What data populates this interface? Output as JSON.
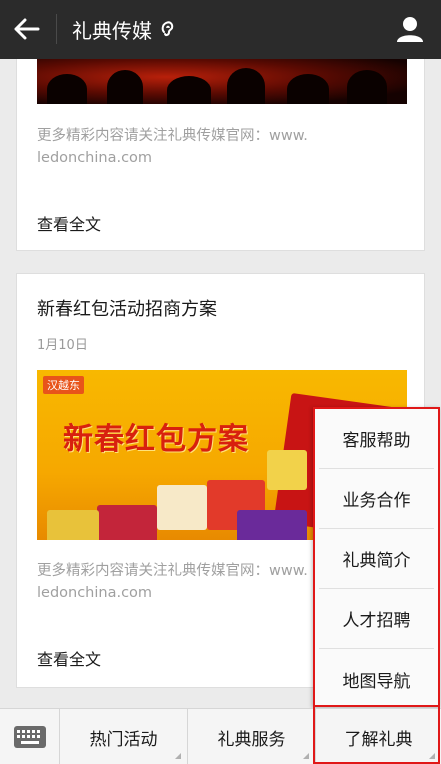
{
  "header": {
    "title": "礼典传媒"
  },
  "articles": [
    {
      "excerpt": "更多精彩内容请关注礼典传媒官网：www.\nledonchina.com",
      "read_more": "查看全文"
    },
    {
      "title": "新春红包活动招商方案",
      "date": "1月10日",
      "banner_logo": "汉越东",
      "banner_text": "新春红包方案",
      "excerpt": "更多精彩内容请关注礼典传媒官网：www.\nledonchina.com",
      "read_more": "查看全文"
    }
  ],
  "bottom_tabs": [
    "热门活动",
    "礼典服务",
    "了解礼典"
  ],
  "popup_menu": [
    "客服帮助",
    "业务合作",
    "礼典简介",
    "人才招聘",
    "地图导航"
  ],
  "colors": {
    "topbar": "#2b2b2b",
    "highlight_border": "#e01818",
    "banner": "#f6a800"
  },
  "icons": {
    "back": "arrow-left-icon",
    "listen": "ear-icon",
    "profile": "user-icon",
    "keyboard": "keyboard-icon"
  }
}
